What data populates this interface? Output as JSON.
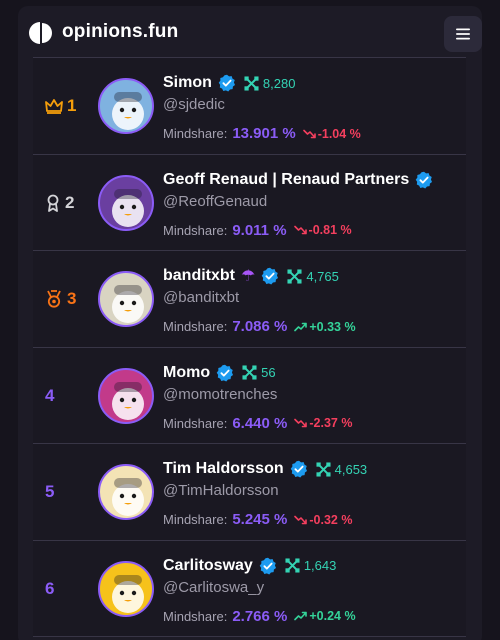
{
  "header": {
    "brand": "opinions.fun"
  },
  "label_mindshare": "Mindshare:",
  "rows": [
    {
      "rank": "1",
      "rank_icon": "crown-icon",
      "rank_color": "#f59e0b",
      "name": "Simon",
      "emoji": "",
      "handle": "@sjdedic",
      "score": "8,280",
      "mindshare": "13.901 %",
      "change": "-1.04 %",
      "trend": "down"
    },
    {
      "rank": "2",
      "rank_icon": "ribbon-icon",
      "rank_color": "#d4d4d8",
      "name": "Geoff Renaud | Renaud Partners",
      "emoji": "",
      "handle": "@ReoffGenaud",
      "score": "",
      "mindshare": "9.011 %",
      "change": "-0.81 %",
      "trend": "down"
    },
    {
      "rank": "3",
      "rank_icon": "medal-icon",
      "rank_color": "#f97316",
      "name": "banditxbt",
      "emoji": "☂",
      "handle": "@banditxbt",
      "score": "4,765",
      "mindshare": "7.086 %",
      "change": "+0.33 %",
      "trend": "up"
    },
    {
      "rank": "4",
      "rank_icon": "",
      "rank_color": "#8b5cf6",
      "name": "Momo",
      "emoji": "",
      "handle": "@momotrenches",
      "score": "56",
      "mindshare": "6.440 %",
      "change": "-2.37 %",
      "trend": "down"
    },
    {
      "rank": "5",
      "rank_icon": "",
      "rank_color": "#8b5cf6",
      "name": "Tim Haldorsson",
      "emoji": "",
      "handle": "@TimHaldorsson",
      "score": "4,653",
      "mindshare": "5.245 %",
      "change": "-0.32 %",
      "trend": "down"
    },
    {
      "rank": "6",
      "rank_icon": "",
      "rank_color": "#8b5cf6",
      "name": "Carlitosway",
      "emoji": "",
      "handle": "@Carlitoswa_y",
      "score": "1,643",
      "mindshare": "2.766 %",
      "change": "+0.24 %",
      "trend": "up"
    }
  ]
}
